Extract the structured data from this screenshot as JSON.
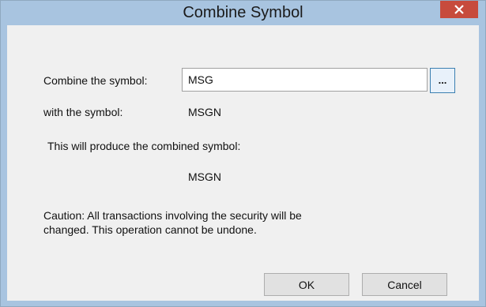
{
  "window": {
    "title": "Combine Symbol",
    "close_icon": "close-icon"
  },
  "form": {
    "combine_label": "Combine the symbol:",
    "combine_value": "MSG",
    "browse_label": "...",
    "with_label": "with the symbol:",
    "with_value": "MSGN",
    "produce_label": "This will produce the combined symbol:",
    "produce_value": "MSGN"
  },
  "caution": {
    "line1": "Caution:  All transactions involving the security will be",
    "line2": "changed.  This operation cannot be undone."
  },
  "buttons": {
    "ok": "OK",
    "cancel": "Cancel"
  },
  "colors": {
    "frame": "#a8c4e0",
    "close": "#c74b3c",
    "client": "#f0f0f0",
    "browse_border": "#3c7fb1"
  }
}
